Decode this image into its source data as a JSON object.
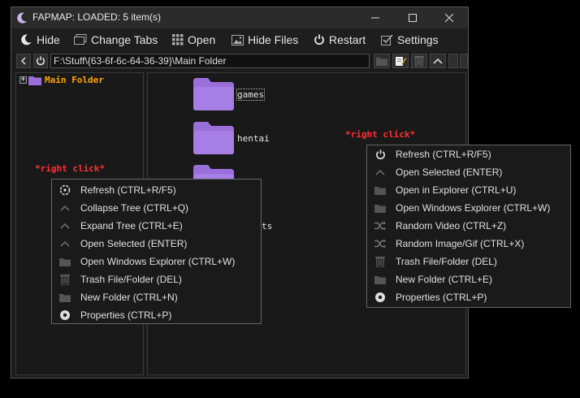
{
  "window": {
    "title": "FAPMAP: LOADED: 5 item(s)",
    "controls": [
      "minimize",
      "maximize",
      "close"
    ]
  },
  "menu": {
    "items": [
      {
        "label": "Hide",
        "icon": "moon-icon"
      },
      {
        "label": "Change Tabs",
        "icon": "tabs-icon"
      },
      {
        "label": "Open",
        "icon": "grid-icon"
      },
      {
        "label": "Hide Files",
        "icon": "image-icon"
      },
      {
        "label": "Restart",
        "icon": "power-icon"
      },
      {
        "label": "Settings",
        "icon": "checkbox-icon"
      }
    ]
  },
  "path": {
    "value": "F:\\Stuff\\{63-6f-6c-64-36-39}\\Main Folder"
  },
  "tree": {
    "root_label": "Main Folder"
  },
  "files": [
    {
      "name": "games"
    },
    {
      "name": "hentai"
    },
    {
      "name": ""
    },
    {
      "name": "ts"
    }
  ],
  "annotations": {
    "left": "*right click*",
    "right": "*right click*"
  },
  "context_left": {
    "items": [
      {
        "label": "Refresh (CTRL+R/F5)",
        "icon": "refresh-icon"
      },
      {
        "label": "Collapse Tree (CTRL+Q)",
        "icon": "chevron-up-icon"
      },
      {
        "label": "Expand Tree (CTRL+E)",
        "icon": "chevron-up-icon"
      },
      {
        "label": "Open Selected (ENTER)",
        "icon": "chevron-up-icon"
      },
      {
        "label": "Open Windows Explorer (CTRL+W)",
        "icon": "folder-icon"
      },
      {
        "label": "Trash File/Folder (DEL)",
        "icon": "trash-icon"
      },
      {
        "label": "New Folder (CTRL+N)",
        "icon": "folder-icon"
      },
      {
        "label": "Properties (CTRL+P)",
        "icon": "gear-icon"
      }
    ]
  },
  "context_right": {
    "items": [
      {
        "label": "Refresh (CTRL+R/F5)",
        "icon": "power-icon"
      },
      {
        "label": "Open Selected (ENTER)",
        "icon": "chevron-up-icon"
      },
      {
        "label": "Open in Explorer (CTRL+U)",
        "icon": "folder-icon"
      },
      {
        "label": "Open Windows Explorer (CTRL+W)",
        "icon": "folder-icon"
      },
      {
        "label": "Random Video (CTRL+Z)",
        "icon": "shuffle-icon"
      },
      {
        "label": "Random Image/Gif (CTRL+X)",
        "icon": "shuffle-icon"
      },
      {
        "label": "Trash File/Folder (DEL)",
        "icon": "trash-icon"
      },
      {
        "label": "New Folder (CTRL+E)",
        "icon": "folder-icon"
      },
      {
        "label": "Properties (CTRL+P)",
        "icon": "gear-icon"
      }
    ]
  },
  "colors": {
    "folder": "#9b6fd9",
    "tree_label": "#ffa500",
    "annotation": "#ff3030"
  }
}
